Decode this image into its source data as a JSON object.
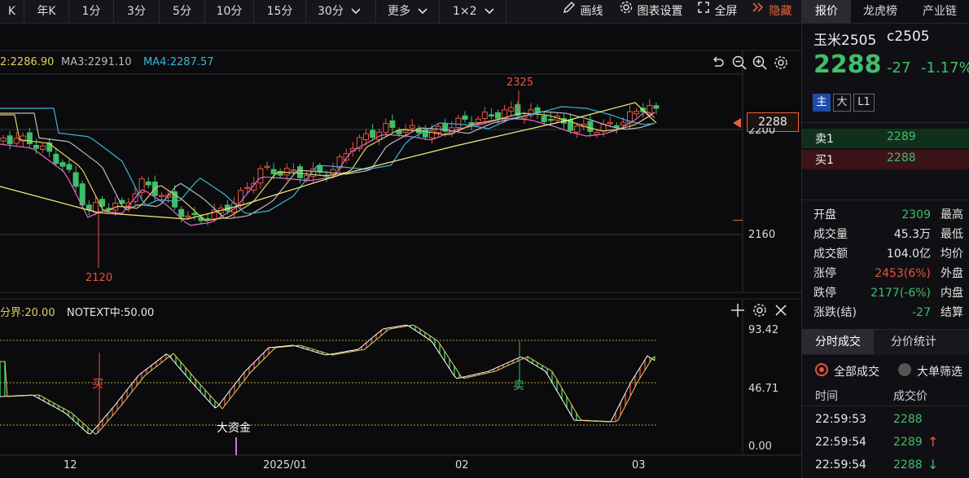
{
  "toolbar": {
    "periods": [
      "K",
      "年K",
      "1分",
      "3分",
      "5分",
      "10分",
      "15分",
      "30分"
    ],
    "more": "更多",
    "layout": "1×2",
    "draw_line": "画线",
    "chart_settings": "图表设置",
    "fullscreen": "全屏",
    "hide": "隐藏"
  },
  "panel": {
    "tabs": [
      "报价",
      "龙虎榜",
      "产业链"
    ],
    "symbol_name": "玉米2505",
    "symbol_code": "c2505",
    "price": "2288",
    "change": "-27",
    "change_pct": "-1.17%",
    "badges": [
      "主",
      "大",
      "L1"
    ],
    "sell1_label": "卖1",
    "sell1_price": "2289",
    "buy1_label": "买1",
    "buy1_price": "2288",
    "stats": [
      {
        "label": "开盘",
        "value": "2309",
        "tail": "最高",
        "color": "green"
      },
      {
        "label": "成交量",
        "value": "45.3万",
        "tail": "最低",
        "color": "white"
      },
      {
        "label": "成交额",
        "value": "104.0亿",
        "tail": "均价",
        "color": "white"
      },
      {
        "label": "涨停",
        "value": "2453(6%)",
        "tail": "外盘",
        "color": "red"
      },
      {
        "label": "跌停",
        "value": "2177(-6%)",
        "tail": "内盘",
        "color": "green"
      },
      {
        "label": "涨跌(结)",
        "value": "-27",
        "tail": "结算",
        "color": "green"
      }
    ],
    "trade_tabs": [
      "分时成交",
      "分价统计"
    ],
    "radio_all": "全部成交",
    "radio_big": "大单筛选",
    "col_time": "时间",
    "col_price": "成交价",
    "trades": [
      {
        "time": "22:59:53",
        "price": "2288",
        "arrow": ""
      },
      {
        "time": "22:59:54",
        "price": "2289",
        "arrow": "↑"
      },
      {
        "time": "22:59:54",
        "price": "2288",
        "arrow": "↓"
      }
    ]
  },
  "main_chart": {
    "ma_labels": [
      {
        "text": "2:2286.90",
        "color": "#e0d060"
      },
      {
        "text": "MA3:2291.10",
        "color": "#bbbbbb"
      },
      {
        "text": "MA4:2287.57",
        "color": "#3ab6d8"
      }
    ],
    "annotations": {
      "high": "2325",
      "low": "2120"
    },
    "price_tag": "2288",
    "y_ticks": [
      "2160"
    ],
    "y_tick_partial": "2200"
  },
  "indicator": {
    "label1": "分界:20.00",
    "label2": "NOTEXT中:50.00",
    "y_ticks": [
      "93.42",
      "46.71",
      "0.00"
    ],
    "buy_signal": "买",
    "sell_signal": "卖",
    "big_money": "大资金"
  },
  "x_axis": {
    "labels": [
      "12",
      "2025/01",
      "02",
      "03"
    ]
  },
  "colors": {
    "up": "#e8553e",
    "down": "#3fbf6a",
    "bg": "#0b0b0d",
    "accent": "#e8623a",
    "yellow": "#e0d060",
    "cyan": "#3ab6d8"
  },
  "icons": [
    "chevron-down-icon",
    "pencil-icon",
    "gear-icon",
    "expand-icon",
    "double-chevron-icon",
    "undo-icon",
    "zoom-out-icon",
    "zoom-in-icon",
    "crosshair-icon",
    "close-icon"
  ]
}
